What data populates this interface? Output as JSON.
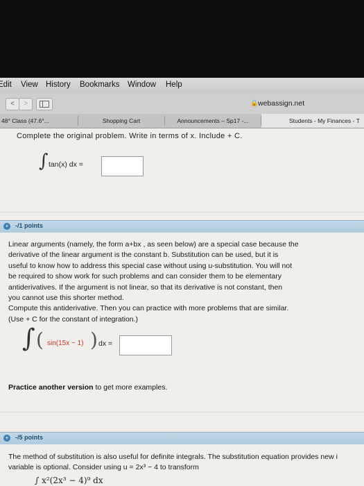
{
  "menubar": {
    "items": [
      "Edit",
      "View",
      "History",
      "Bookmarks",
      "Window",
      "Help"
    ]
  },
  "toolbar": {
    "back": "<",
    "forward": ">",
    "url": "webassign.net"
  },
  "tabs": [
    {
      "label": "48° Class (47.6°..."
    },
    {
      "label": "Shopping Cart"
    },
    {
      "label": "Announcements – Sp17 -..."
    },
    {
      "label": "Students - My Finances - T"
    }
  ],
  "problem_top": {
    "instruction": "Complete the original problem. Write in terms of x. Include + C.",
    "integral_symbol": "∫",
    "expression": "tan(x) dx =",
    "answer": ""
  },
  "question2": {
    "points": "-/1 points",
    "lines": [
      "Linear arguments (namely, the form a+bx , as seen below) are a special case because the",
      "derivative of the linear argument is the constant b. Substitution can be used, but it is",
      "useful to know how to address this special case without using u-substitution. You will not",
      "be required to show work for such problems and can consider them to be elementary",
      "antiderivatives. If the argument is not linear, so that its derivative is not constant, then",
      "you cannot use this shorter method.",
      "Compute this antiderivative. Then you can practice with more problems that are similar.",
      "(Use + C for the constant of integration.)"
    ],
    "integral_symbol": "∫",
    "expr_inner": "sin(15x − 1)",
    "expr_tail": "dx =",
    "answer": "",
    "practice_bold": "Practice another version",
    "practice_rest": " to get more examples."
  },
  "question3": {
    "points": "-/5 points",
    "line1": "The method of substitution is also useful for definite integrals. The substitution equation provides new i",
    "line2": "variable is optional. Consider using  u = 2x³ − 4  to transform",
    "integral_preview": "∫ x²(2x³ − 4)⁹ dx"
  }
}
